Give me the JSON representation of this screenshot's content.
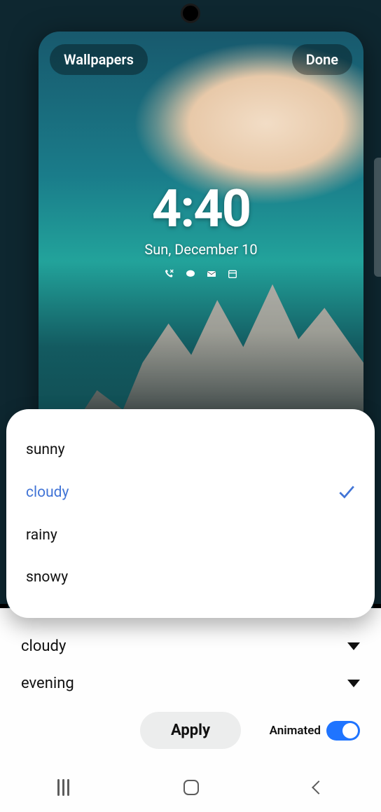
{
  "header": {
    "wallpapers_label": "Wallpapers",
    "done_label": "Done"
  },
  "lock_screen": {
    "time": "4:40",
    "date": "Sun, December 10",
    "notification_icons": [
      "missed-call",
      "messages",
      "mail",
      "calendar"
    ]
  },
  "weather_options": {
    "items": [
      {
        "label": "sunny",
        "selected": false
      },
      {
        "label": "cloudy",
        "selected": true
      },
      {
        "label": "rainy",
        "selected": false
      },
      {
        "label": "snowy",
        "selected": false
      }
    ]
  },
  "settings": {
    "weather_selected": "cloudy",
    "time_of_day_selected": "evening",
    "apply_label": "Apply",
    "animated_label": "Animated",
    "animated_on": true
  },
  "colors": {
    "accent": "#1f74ff",
    "option_selected": "#4174d6"
  }
}
